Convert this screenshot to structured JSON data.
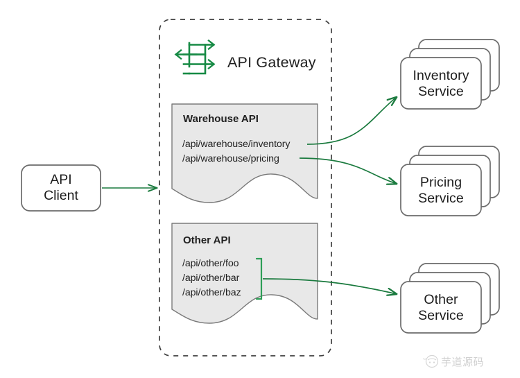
{
  "diagram": {
    "title": "API Gateway routing diagram",
    "colors": {
      "arrow_green": "#1a7a3e",
      "arrow_green_light": "#2e9e57",
      "box_stroke": "#6b6b6b",
      "api_box_fill": "#e8e8e8",
      "api_box_stroke": "#7a7a7a",
      "dashed_stroke": "#3f3f3f",
      "text": "#1f1f1f"
    }
  },
  "client": {
    "label_line1": "API",
    "label_line2": "Client"
  },
  "gateway": {
    "title": "API Gateway",
    "icon_name": "api-exchange-icon",
    "api_boxes": [
      {
        "id": "warehouse-api",
        "title": "Warehouse API",
        "routes": [
          "/api/warehouse/inventory",
          "/api/warehouse/pricing"
        ],
        "grouped": false
      },
      {
        "id": "other-api",
        "title": "Other API",
        "routes": [
          "/api/other/foo",
          "/api/other/bar",
          "/api/other/baz"
        ],
        "grouped": true
      }
    ]
  },
  "services": [
    {
      "id": "inventory-service",
      "label_line1": "Inventory",
      "label_line2": "Service",
      "instances": 3
    },
    {
      "id": "pricing-service",
      "label_line1": "Pricing",
      "label_line2": "Service",
      "instances": 3
    },
    {
      "id": "other-service",
      "label_line1": "Other",
      "label_line2": "Service",
      "instances": 3
    }
  ],
  "connections": [
    {
      "from": "client",
      "to": "gateway",
      "style": "straight-arrow"
    },
    {
      "from": "/api/warehouse/inventory",
      "to": "inventory-service",
      "style": "curved-arrow"
    },
    {
      "from": "/api/warehouse/pricing",
      "to": "pricing-service",
      "style": "curved-arrow"
    },
    {
      "from": "other-api-group",
      "to": "other-service",
      "style": "curved-arrow"
    }
  ],
  "watermark": {
    "text": "芋道源码"
  }
}
